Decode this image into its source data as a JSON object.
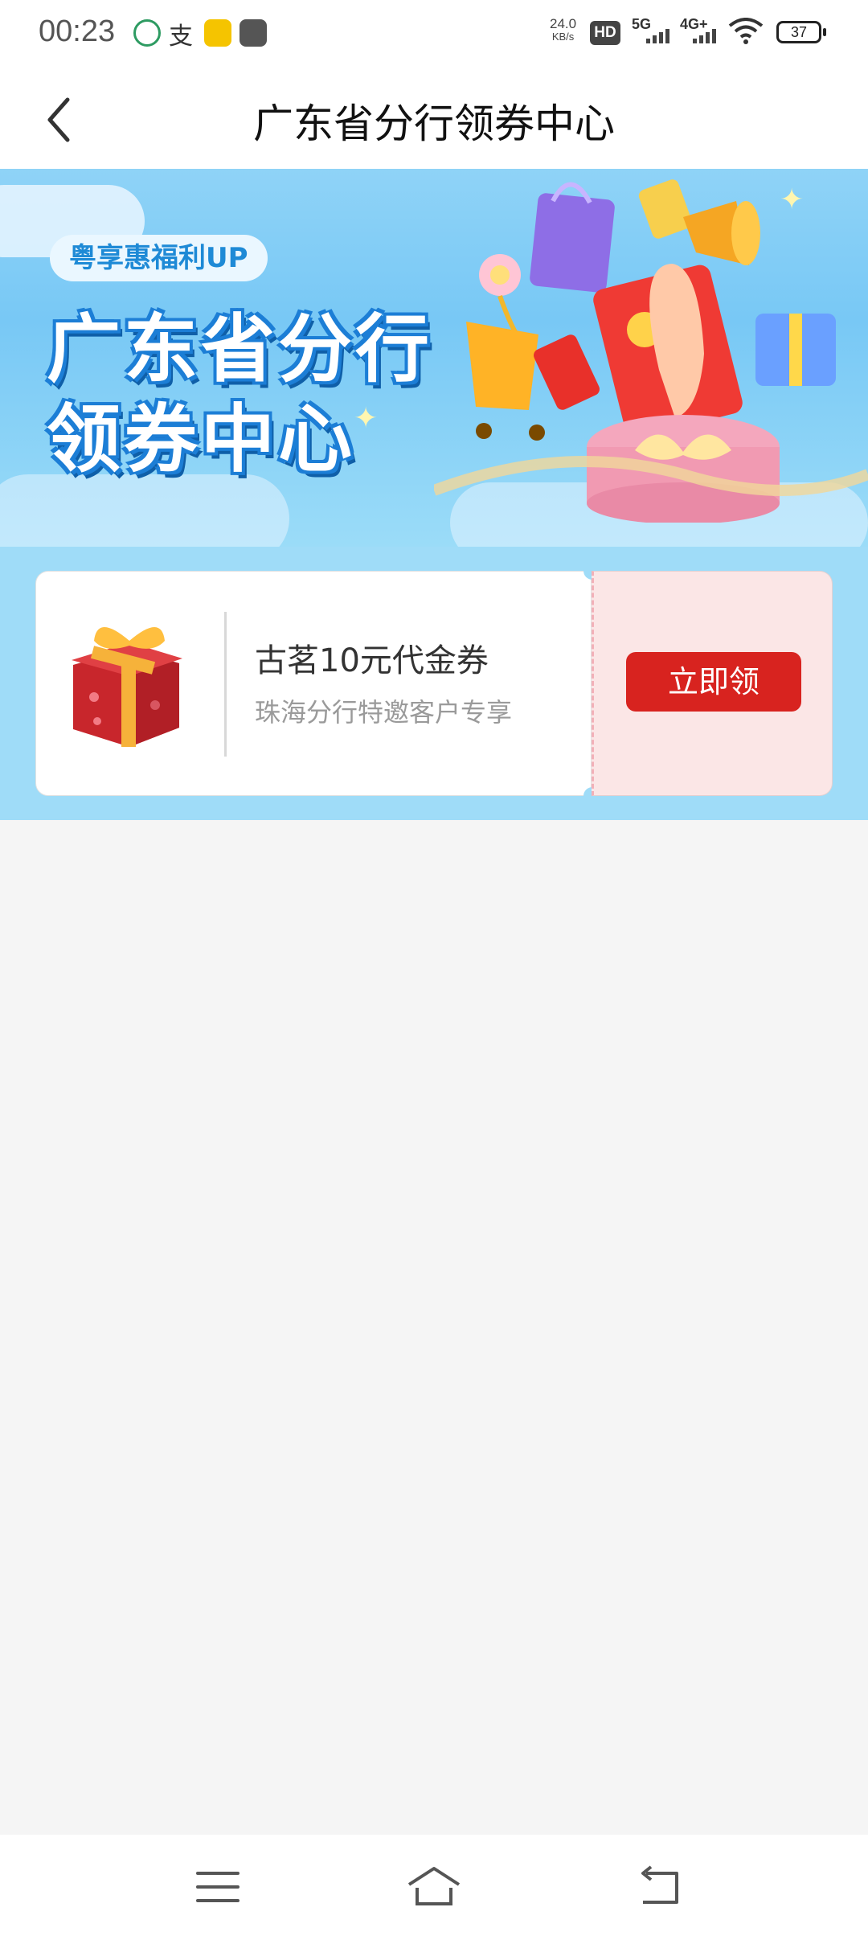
{
  "status_bar": {
    "time": "00:23",
    "net_speed_value": "24.0",
    "net_speed_unit": "KB/s",
    "hd_label": "HD",
    "sim1": "5G",
    "sim2": "4G+",
    "battery": "37"
  },
  "header": {
    "title": "广东省分行领券中心"
  },
  "banner": {
    "badge": "粤享惠福利UP",
    "title_line1": "广东省分行",
    "title_line2": "领券中心"
  },
  "coupons": [
    {
      "name": "古茗10元代金券",
      "description": "珠海分行特邀客户专享",
      "button_label": "立即领"
    }
  ],
  "colors": {
    "accent_red": "#d8231f",
    "banner_blue": "#78c8f5",
    "page_bg": "#f5f5f5"
  }
}
